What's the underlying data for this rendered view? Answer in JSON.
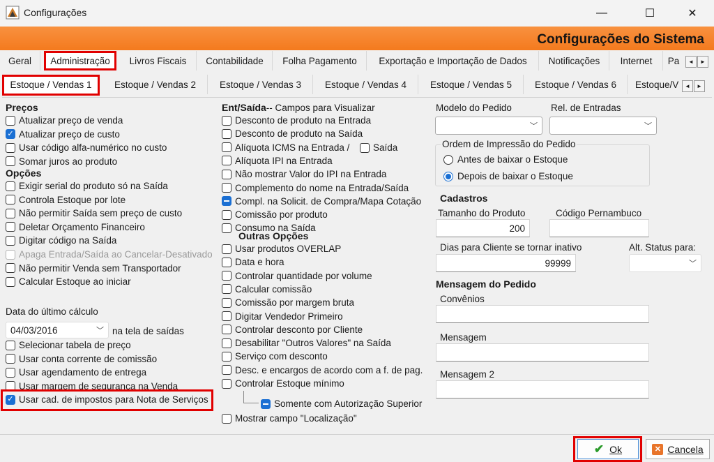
{
  "window": {
    "title": "Configurações",
    "min": "—",
    "max": "☐",
    "close": "✕"
  },
  "banner": {
    "title": "Configurações do Sistema"
  },
  "tabs_main": [
    "Geral",
    "Administração",
    "Livros Fiscais",
    "Contabilidade",
    "Folha Pagamento",
    "Exportação e Importação de Dados",
    "Notificações",
    "Internet",
    "Pa"
  ],
  "tabs_sub": [
    "Estoque / Vendas 1",
    "Estoque / Vendas 2",
    "Estoque / Vendas 3",
    "Estoque / Vendas 4",
    "Estoque / Vendas 5",
    "Estoque / Vendas 6",
    "Estoque/V"
  ],
  "scroll": {
    "left": "◄",
    "right": "►"
  },
  "col1": {
    "precos": "Preços",
    "precos_items": [
      {
        "label": "Atualizar preço de venda",
        "state": "off"
      },
      {
        "label": "Atualizar preço de custo",
        "state": "on"
      },
      {
        "label": "Usar código alfa-numérico no custo",
        "state": "off"
      },
      {
        "label": "Somar juros ao produto",
        "state": "off"
      }
    ],
    "opcoes": "Opções",
    "opcoes_items": [
      {
        "label": "Exigir serial  do produto só na Saída",
        "state": "off"
      },
      {
        "label": "Controla Estoque por lote",
        "state": "off"
      },
      {
        "label": "Não permitir Saída sem preço de custo",
        "state": "off"
      },
      {
        "label": "Deletar Orçamento Financeiro",
        "state": "off"
      },
      {
        "label": "Digitar código na Saída",
        "state": "off"
      },
      {
        "label": "Apaga Entrada/Saída ao Cancelar-Desativado",
        "state": "dis"
      },
      {
        "label": "Não permitir Venda sem Transportador",
        "state": "off"
      },
      {
        "label": "Calcular Estoque ao iniciar",
        "state": "off"
      }
    ],
    "data_label": "Data do último cálculo",
    "data_value": "04/03/2016",
    "data_suffix": "na tela de saídas",
    "lower_items": [
      {
        "label": "Selecionar tabela de preço",
        "state": "off"
      },
      {
        "label": "Usar conta corrente de comissão",
        "state": "off"
      },
      {
        "label": "Usar agendamento de entrega",
        "state": "off"
      },
      {
        "label": "Usar margem de segurança na Venda",
        "state": "off"
      },
      {
        "label": "Usar cad. de impostos para Nota de Serviços",
        "state": "on"
      }
    ]
  },
  "col2": {
    "header_bold": "Ent/Saída",
    "header_rest": "-- Campos para Visualizar",
    "items": [
      {
        "label": "Desconto de produto na Entrada",
        "state": "off"
      },
      {
        "label": "Desconto de produto na Saída",
        "state": "off"
      },
      {
        "label": "Alíquota ICMS na Entrada /",
        "state": "off"
      },
      {
        "label": "Alíquota IPI na Entrada",
        "state": "off"
      },
      {
        "label": "Não mostrar Valor do IPI na Entrada",
        "state": "off"
      },
      {
        "label": "Complemento do nome na Entrada/Saída",
        "state": "off"
      },
      {
        "label": "Compl. na Solicit. de Compra/Mapa Cotação",
        "state": "ind"
      },
      {
        "label": "Comissão por produto",
        "state": "off"
      },
      {
        "label": "Consumo na Saída",
        "state": "off"
      }
    ],
    "saida_label": "Saída",
    "outras": "Outras Opções",
    "outras_items": [
      {
        "label": "Usar produtos OVERLAP",
        "state": "off"
      },
      {
        "label": "Data e hora",
        "state": "off"
      },
      {
        "label": "Controlar quantidade por volume",
        "state": "off"
      },
      {
        "label": "Calcular comissão",
        "state": "off"
      },
      {
        "label": "Comissão por margem bruta",
        "state": "off"
      },
      {
        "label": "Digitar Vendedor Primeiro",
        "state": "off"
      },
      {
        "label": "Controlar desconto por Cliente",
        "state": "off"
      },
      {
        "label": "Desabilitar \"Outros Valores\" na Saída",
        "state": "off"
      },
      {
        "label": "Serviço com desconto",
        "state": "off"
      },
      {
        "label": "Desc. e encargos de acordo com a f. de pag.",
        "state": "off"
      },
      {
        "label": "Controlar Estoque mínimo",
        "state": "off"
      }
    ],
    "sub_item": "Somente com Autorização Superior",
    "last_item": "Mostrar campo \"Localização\""
  },
  "col3": {
    "modelo_label": "Modelo do Pedido",
    "rel_label": "Rel. de Entradas",
    "ordem_label": "Ordem de Impressão do Pedido",
    "ordem_opt1": "Antes de baixar o Estoque",
    "ordem_opt2": "Depois de baixar o Estoque",
    "cadastros": "Cadastros",
    "tamanho_label": "Tamanho do Produto",
    "tamanho_value": "200",
    "pernambuco_label": "Código Pernambuco",
    "dias_label": "Dias para Cliente se tornar inativo",
    "dias_value": "99999",
    "alt_label": "Alt. Status para:",
    "mensagem_header": "Mensagem do Pedido",
    "convenios_label": "Convênios",
    "mensagem_label": "Mensagem",
    "mensagem2_label": "Mensagem 2"
  },
  "footer": {
    "ok": "Ok",
    "cancel": "Cancela"
  }
}
